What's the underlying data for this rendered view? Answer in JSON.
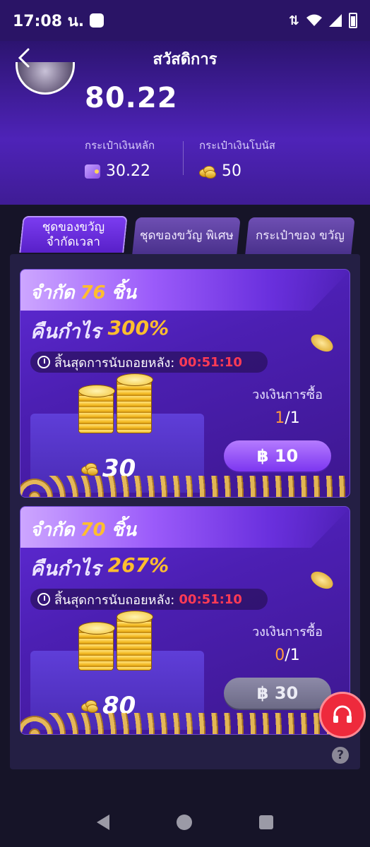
{
  "status_bar": {
    "time": "17:08 น."
  },
  "header": {
    "title": "สวัสดิการ",
    "balance": "80.22"
  },
  "wallets": {
    "main": {
      "label": "กระเป๋าเงินหลัก",
      "value": "30.22"
    },
    "bonus": {
      "label": "กระเป๋าเงินโบนัส",
      "value": "50"
    }
  },
  "tabs": [
    {
      "label": "ชุดของขวัญ จำกัดเวลา",
      "active": true
    },
    {
      "label": "ชุดของขวัญ พิเศษ",
      "active": false
    },
    {
      "label": "กระเป๋าของ ขวัญ",
      "active": false
    }
  ],
  "cards": [
    {
      "limit_prefix": "จำกัด",
      "limit_count": "76",
      "limit_suffix": "ชิ้น",
      "profit_prefix": "คืนกำไร",
      "profit_pct": "300%",
      "countdown_label": "สิ้นสุดการนับถอยหลัง:",
      "countdown": "00:51:10",
      "coins": "30",
      "quota_label": "วงเงินการซื้อ",
      "quota_used": "1",
      "quota_total": "/1",
      "price": "฿ 10",
      "enabled": true
    },
    {
      "limit_prefix": "จำกัด",
      "limit_count": "70",
      "limit_suffix": "ชิ้น",
      "profit_prefix": "คืนกำไร",
      "profit_pct": "267%",
      "countdown_label": "สิ้นสุดการนับถอยหลัง:",
      "countdown": "00:51:10",
      "coins": "80",
      "quota_label": "วงเงินการซื้อ",
      "quota_used": "0",
      "quota_total": "/1",
      "price": "฿ 30",
      "enabled": false
    }
  ],
  "help_mark": "?",
  "colors": {
    "accent": "#7c36f0",
    "highlight": "#ffbe2e",
    "timer": "#ff3b55",
    "support": "#ee2a3c"
  },
  "icons": [
    "back-icon",
    "wallet-icon",
    "coins-icon",
    "clock-icon",
    "headset-icon",
    "help-icon"
  ]
}
